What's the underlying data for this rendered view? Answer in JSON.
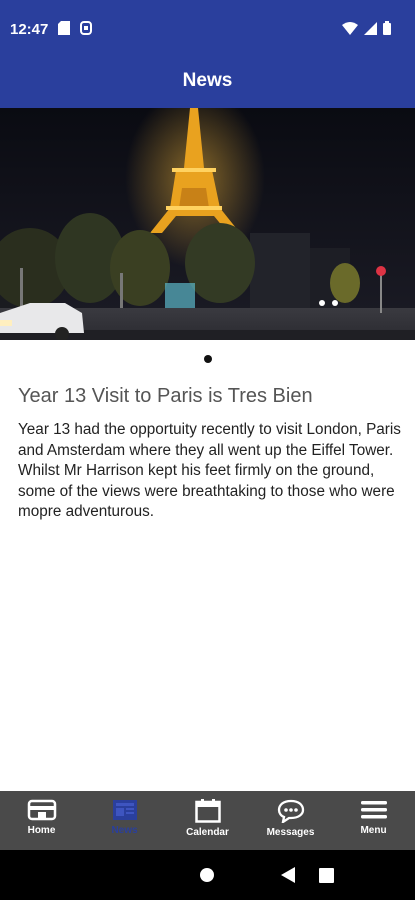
{
  "status": {
    "time": "12:47"
  },
  "appbar": {
    "title": "News"
  },
  "article": {
    "title": "Year 13 Visit to Paris is Tres Bien",
    "body": "Year 13 had the opportuity recently to visit London, Paris and Amsterdam where they all went up the Eiffel Tower.  Whilst Mr Harrison kept his feet firmly on the ground, some of the views were breathtaking to those who were mopre adventurous."
  },
  "tabs": [
    {
      "label": "Home",
      "icon": "home-icon"
    },
    {
      "label": "News",
      "icon": "news-icon"
    },
    {
      "label": "Calendar",
      "icon": "calendar-icon"
    },
    {
      "label": "Messages",
      "icon": "messages-icon"
    },
    {
      "label": "Menu",
      "icon": "menu-icon"
    }
  ],
  "colors": {
    "primary": "#2a3f9d",
    "tabbar": "#4a4a4a",
    "text": "#222222"
  }
}
